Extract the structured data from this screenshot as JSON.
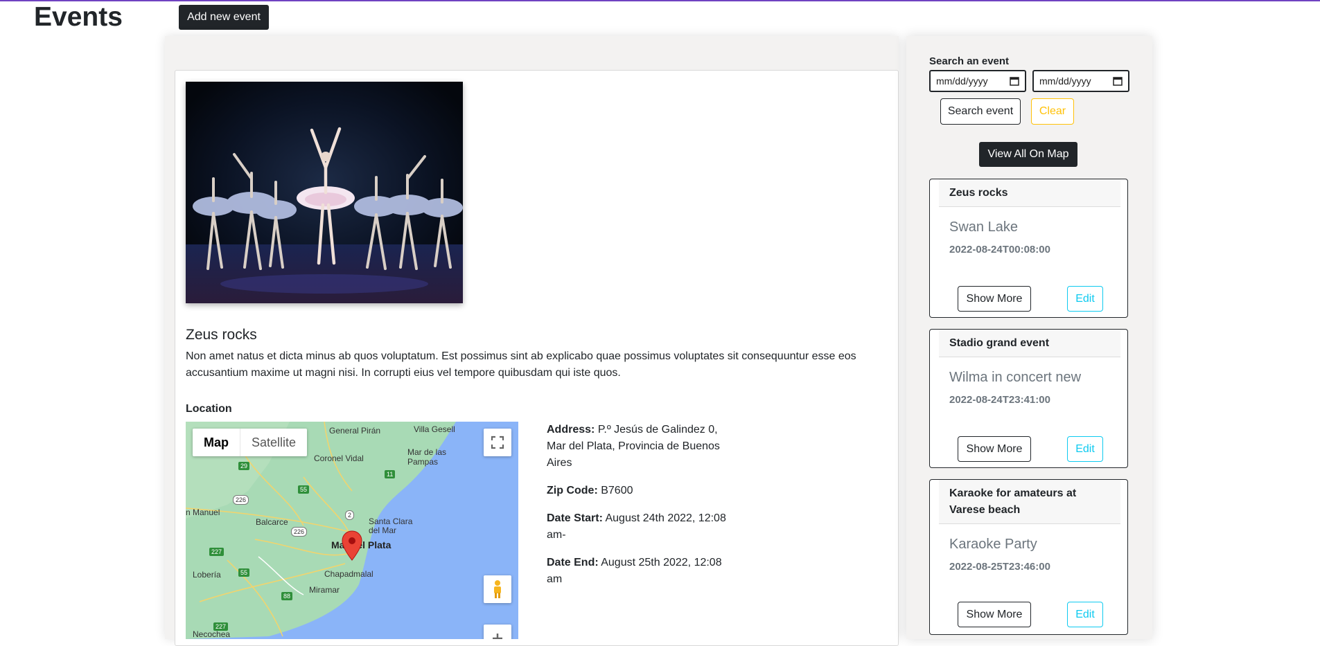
{
  "header": {
    "title": "Events",
    "add_button": "Add new event",
    "accent_color": "#6f42c1"
  },
  "event_detail": {
    "image_icon": "ballet-dancers-photo",
    "title": "Zeus rocks",
    "description": "Non amet natus et dicta minus ab quos voluptatum. Est possimus sint ab explicabo quae possimus voluptates sit consequuntur esse eos accusantium maxime ut magni nisi. In corrupti eius vel tempore quibusdam qui iste quos.",
    "location_label": "Location",
    "address_label": "Address:",
    "address": "P.º Jesús de Galindez 0, Mar del Plata, Provincia de Buenos Aires",
    "zip_label": "Zip Code:",
    "zip": "B7600",
    "start_label": "Date Start:",
    "start": "August 24th 2022, 12:08 am-",
    "end_label": "Date End:",
    "end": "August 25th 2022, 12:08 am"
  },
  "map": {
    "type_map": "Map",
    "type_satellite": "Satellite",
    "places": {
      "villa_gesell": "Villa Gesell",
      "general_piran": "General Pirán",
      "coronel_vidal": "Coronel Vidal",
      "mar_de_las_pampas": "Mar de las Pampas",
      "n_manuel": "n Manuel",
      "balcarce": "Balcarce",
      "santa_clara": "Santa Clara del Mar",
      "mar_del_plata": "Mar del Plata",
      "loberia": "Lobería",
      "chapadmalal": "Chapadmalal",
      "miramar": "Miramar",
      "necochea": "Necochea"
    },
    "routes": {
      "r29": "29",
      "r55a": "55",
      "r11": "11",
      "r226a": "226",
      "r2": "2",
      "r226b": "226",
      "r227a": "227",
      "r55b": "55",
      "r88": "88",
      "r227b": "227"
    },
    "icons": [
      "fullscreen-icon",
      "pegman-icon",
      "zoom-in-icon",
      "map-pin-icon"
    ]
  },
  "search": {
    "label": "Search an event",
    "date_from_placeholder": "mm/dd/yyyy",
    "date_to_placeholder": "mm/dd/yyyy",
    "search_button": "Search event",
    "clear_button": "Clear",
    "view_all_button": "View All On Map"
  },
  "event_list": [
    {
      "header": "Zeus rocks",
      "name": "Swan Lake",
      "date": "2022-08-24T00:08:00",
      "more": "Show More",
      "edit": "Edit"
    },
    {
      "header": "Stadio grand event",
      "name": "Wilma in concert new",
      "date": "2022-08-24T23:41:00",
      "more": "Show More",
      "edit": "Edit"
    },
    {
      "header": "Karaoke for amateurs at Varese beach",
      "name": "Karaoke Party",
      "date": "2022-08-25T23:46:00",
      "more": "Show More",
      "edit": "Edit"
    }
  ]
}
